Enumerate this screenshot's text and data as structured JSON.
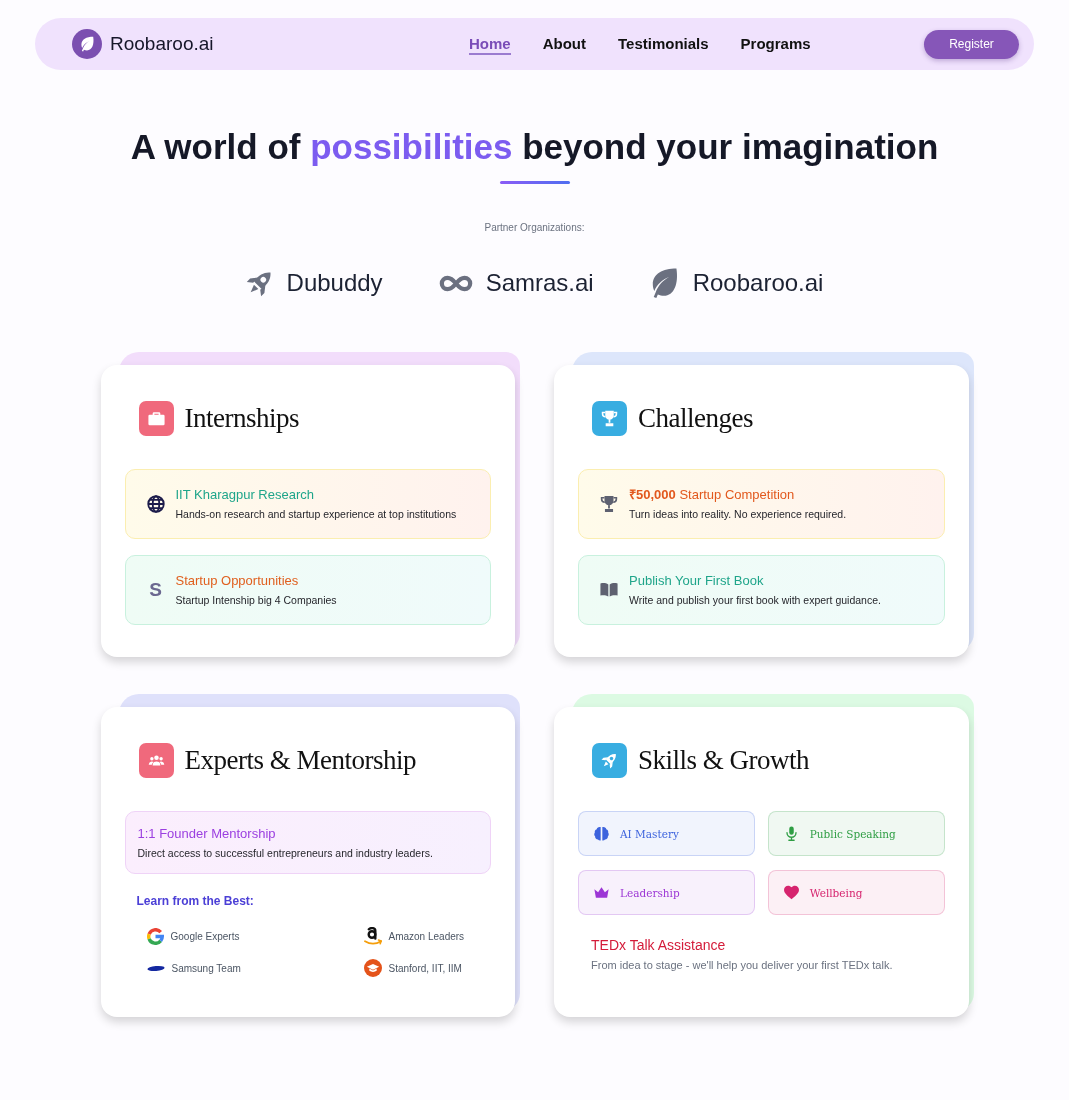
{
  "nav": {
    "brand": "Roobaroo.ai",
    "links": [
      {
        "label": "Home",
        "selected": true
      },
      {
        "label": "About",
        "selected": false
      },
      {
        "label": "Testimonials",
        "selected": false
      },
      {
        "label": "Programs",
        "selected": false
      }
    ],
    "button": "Register"
  },
  "hero": {
    "before": "A world of",
    "highlight": "possibilities",
    "after": "beyond your imagination"
  },
  "partners": {
    "label": "Partner Organizations:",
    "items": [
      {
        "name": "Dubuddy"
      },
      {
        "name": "Samras.ai"
      },
      {
        "name": "Roobaroo.ai"
      }
    ]
  },
  "cards": [
    {
      "title": "Internships",
      "color": "#f2ddfb",
      "items": [
        {
          "title": "IIT Kharagpur Research",
          "text": "Hands-on research and startup experience at top institutions",
          "color": "#1fa58a",
          "kind": "amber"
        },
        {
          "glyph": "S",
          "title": "Startup Opportunities",
          "text": "Startup Intenship big 4 Companies",
          "color": "#e0601f",
          "kind": "mint"
        }
      ]
    },
    {
      "title": "Challenges",
      "color": "#dde6fb",
      "items": [
        {
          "title": "**₹50,000** Startup Competition",
          "text": "Turn ideas into reality. No experience required.",
          "color": "#e2581d",
          "kind": "amber"
        },
        {
          "title": "Publish Your First Book",
          "text": "Write and publish your first book with expert guidance.",
          "color": "#1fa58a",
          "kind": "mint"
        }
      ]
    },
    {
      "title": "Experts & Mentorship",
      "color": "#dfe1fb",
      "items": [
        {
          "title": "1:1 Founder Mentorship",
          "text": "Direct access to successful entrepreneurs and industry leaders.",
          "color": "#9b3fe0",
          "kind": "violet"
        }
      ],
      "learn": {
        "heading": "Learn from the Best:",
        "entries": [
          {
            "name": "Google Experts"
          },
          {
            "name": "Amazon Leaders"
          },
          {
            "name": "Samsung Team"
          },
          {
            "name": "Stanford, IIT, IIM"
          }
        ]
      }
    },
    {
      "title": "Skills & Growth",
      "color": "#dcfae3",
      "skills": [
        {
          "label": "AI Mastery",
          "color": "#3d63dd"
        },
        {
          "label": "Public Speaking",
          "color": "#2f9e44"
        },
        {
          "label": "Leadership",
          "color": "#9c36d5"
        },
        {
          "label": "Wellbeing",
          "color": "#d6246e"
        }
      ],
      "highlight": {
        "title": "TEDx Talk Assistance",
        "text": "From idea to stage - we'll help you deliver your first TEDx talk."
      }
    }
  ]
}
